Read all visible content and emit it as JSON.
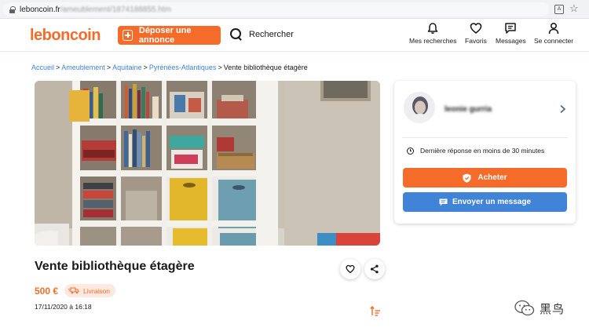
{
  "browser": {
    "url_domain": "leboncoin.fr",
    "url_path": "/ameublement/1874188855.htm"
  },
  "header": {
    "logo": "leboncoin",
    "deposit_label": "Déposer une annonce",
    "search_label": "Rechercher",
    "nav": [
      {
        "label": "Mes recherches",
        "icon": "bell-icon"
      },
      {
        "label": "Favoris",
        "icon": "heart-icon"
      },
      {
        "label": "Messages",
        "icon": "message-icon"
      },
      {
        "label": "Se connecter",
        "icon": "user-icon"
      }
    ]
  },
  "breadcrumb": [
    {
      "label": "Accueil"
    },
    {
      "label": "Ameublement"
    },
    {
      "label": "Aquitaine"
    },
    {
      "label": "Pyrénées-Atlantiques"
    },
    {
      "label": "Vente bibliothèque étagère"
    }
  ],
  "ad": {
    "title": "Vente bibliothèque étagère",
    "price": "500 €",
    "delivery_label": "Livraison",
    "date": "17/11/2020 à 16:18"
  },
  "seller": {
    "name": "leonie gurria",
    "response_time": "Dernière réponse en moins de 30 minutes",
    "buy_label": "Acheter",
    "message_label": "Envoyer un message"
  },
  "watermark": {
    "text": "黑鸟"
  },
  "colors": {
    "brand_orange": "#f56b2a",
    "link_blue": "#4183d7"
  }
}
